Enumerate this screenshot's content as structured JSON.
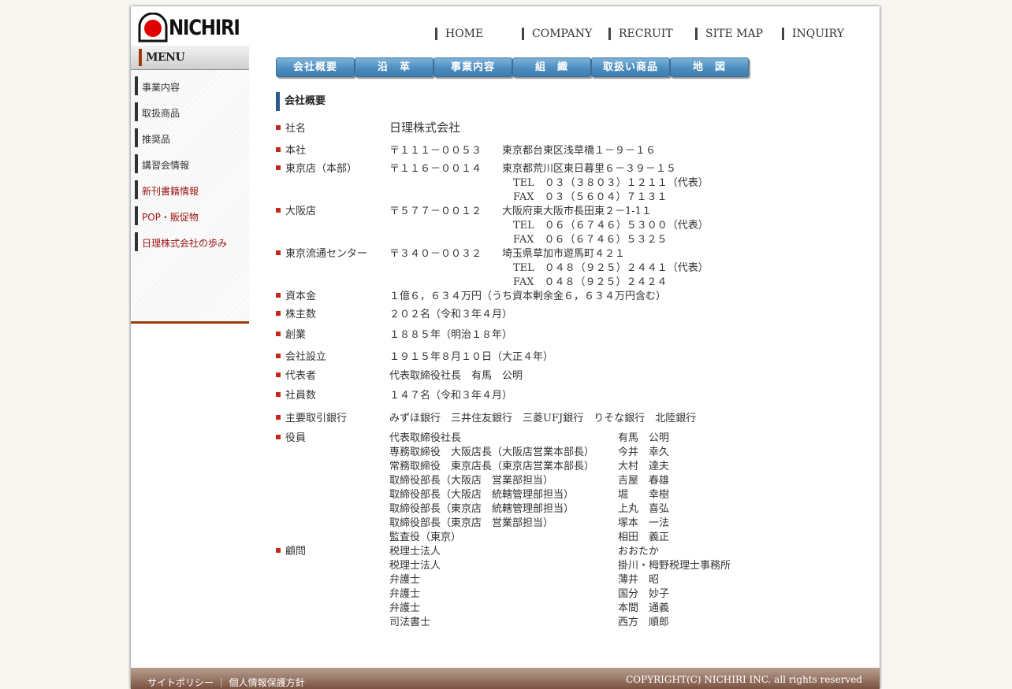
{
  "brand": {
    "logo_text": "NICHIRI",
    "colors": {
      "logo_red": "#e00000",
      "tab_blue": "#4d8dbf",
      "accent_brown": "#a03a0c",
      "marker_red": "#c8261c"
    }
  },
  "topnav": [
    "HOME",
    "COMPANY",
    "RECRUIT",
    "SITE MAP",
    "INQUIRY"
  ],
  "sidebar": {
    "title": "MENU",
    "items": [
      {
        "label": "事業内容",
        "color": "#333333"
      },
      {
        "label": "取扱商品",
        "color": "#333333"
      },
      {
        "label": "推奨品",
        "color": "#333333"
      },
      {
        "label": "講習会情報",
        "color": "#333333"
      },
      {
        "label": "新刊書籍情報",
        "color": "#9a1010"
      },
      {
        "label": "POP・販促物",
        "color": "#9a1010"
      },
      {
        "label": "日理株式会社の歩み",
        "color": "#9a1010"
      }
    ]
  },
  "tabs": [
    "会社概要",
    "沿　革",
    "事業内容",
    "組　織",
    "取扱い商品",
    "地　図"
  ],
  "content": {
    "heading": "会社概要",
    "rows": [
      {
        "key": "社名",
        "lines": [
          [
            "日理株式会社"
          ]
        ]
      },
      {
        "key": "本社",
        "lines": [
          [
            "〒１１１－００５３",
            "東京都台東区浅草橋１－９－１６"
          ]
        ]
      },
      {
        "key": "東京店（本部）",
        "lines": [
          [
            "〒１１６－００１４",
            "東京都荒川区東日暮里６－３９－１５"
          ],
          [
            "",
            "TEL　０３（３８０３）１２１１（代表）"
          ],
          [
            "",
            "FAX　０３（５６０４）７１３１"
          ]
        ]
      },
      {
        "key": "大阪店",
        "lines": [
          [
            "〒５７７－００１２",
            "大阪府東大阪市長田東２－1-1１"
          ],
          [
            "",
            "TEL　０６（６７４６）５３００（代表）"
          ],
          [
            "",
            "FAX　０６（６７４６）５３２５"
          ]
        ]
      },
      {
        "key": "東京流通センター",
        "lines": [
          [
            "〒３４０－００３２",
            "埼玉県草加市遊馬町４２１"
          ],
          [
            "",
            "TEL　０４８（９２５）２４４１（代表）"
          ],
          [
            "",
            "FAX　０４８（９２５）２４２４"
          ]
        ]
      },
      {
        "key": "資本金",
        "lines": [
          [
            "１億６，６３４万円（うち資本剰余金６，６３４万円含む）"
          ]
        ]
      },
      {
        "key": "株主数",
        "lines": [
          [
            "２０２名（令和３年４月）"
          ]
        ]
      },
      {
        "key": "創業",
        "lines": [
          [
            "１８８５年（明治１８年）"
          ]
        ]
      },
      {
        "key": "会社設立",
        "lines": [
          [
            "１９１５年８月１０日（大正４年）"
          ]
        ]
      },
      {
        "key": "代表者",
        "lines": [
          [
            "代表取締役社長　有馬　公明"
          ]
        ]
      },
      {
        "key": "社員数",
        "lines": [
          [
            "１４７名（令和３年４月）"
          ]
        ]
      },
      {
        "key": "主要取引銀行",
        "lines": [
          [
            "みずほ銀行　三井住友銀行　三菱UFJ銀行　りそな銀行　北陸銀行"
          ]
        ]
      }
    ],
    "officers": {
      "key": "役員",
      "people": [
        [
          "代表取締役社長",
          "有馬　公明"
        ],
        [
          "専務取締役　大阪店長（大阪店営業本部長）",
          "今井　幸久"
        ],
        [
          "常務取締役　東京店長（東京店営業本部長）",
          "大村　達夫"
        ],
        [
          "取締役部長（大阪店　営業部担当）",
          "吉屋　春雄"
        ],
        [
          "取締役部長（大阪店　統轄管理部担当）",
          "堀　　幸樹"
        ],
        [
          "取締役部長（東京店　統轄管理部担当）",
          "上丸　喜弘"
        ],
        [
          "取締役部長（東京店　営業部担当）",
          "塚本　一法"
        ],
        [
          "監査役（東京）",
          "相田　義正"
        ]
      ]
    },
    "advisors": {
      "key": "顧問",
      "people": [
        [
          "税理士法人",
          "おおたか"
        ],
        [
          "税理士法人",
          "掛川・栂野税理士事務所"
        ],
        [
          "弁護士",
          "薄井　昭"
        ],
        [
          "弁護士",
          "国分　妙子"
        ],
        [
          "弁護士",
          "本間　通義"
        ],
        [
          "司法書士",
          "西方　順郎"
        ]
      ]
    }
  },
  "footer": {
    "left": "サイトポリシー ｜ 個人情報保護方針",
    "right": "COPYRIGHT(C) NICHIRI INC.  all rights reserved"
  }
}
